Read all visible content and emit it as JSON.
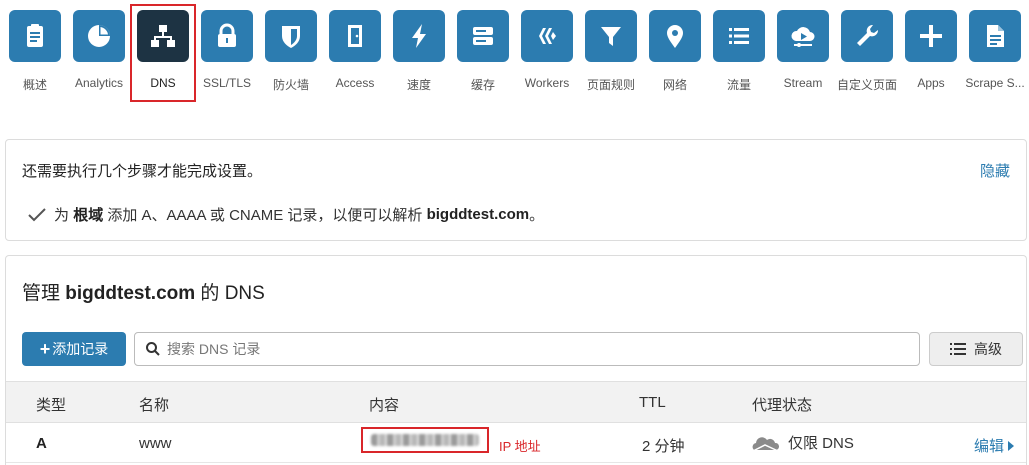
{
  "nav": {
    "items": [
      {
        "label": "概述",
        "icon": "clipboard-icon"
      },
      {
        "label": "Analytics",
        "icon": "pie-chart-icon"
      },
      {
        "label": "DNS",
        "icon": "network-icon"
      },
      {
        "label": "SSL/TLS",
        "icon": "lock-icon"
      },
      {
        "label": "防火墙",
        "icon": "shield-icon"
      },
      {
        "label": "Access",
        "icon": "door-icon"
      },
      {
        "label": "速度",
        "icon": "lightning-icon"
      },
      {
        "label": "缓存",
        "icon": "server-icon"
      },
      {
        "label": "Workers",
        "icon": "workers-icon"
      },
      {
        "label": "页面规则",
        "icon": "filter-icon"
      },
      {
        "label": "网络",
        "icon": "location-pin-icon"
      },
      {
        "label": "流量",
        "icon": "list-icon"
      },
      {
        "label": "Stream",
        "icon": "cloud-play-icon"
      },
      {
        "label": "自定义页面",
        "icon": "wrench-icon"
      },
      {
        "label": "Apps",
        "icon": "plus-icon"
      },
      {
        "label": "Scrape S...",
        "icon": "document-icon"
      }
    ],
    "active": "DNS",
    "accent_color": "#2c7cb0",
    "active_color": "#1d3343"
  },
  "setup": {
    "title": "还需要执行几个步骤才能完成设置。",
    "hide_label": "隐藏",
    "step_prefix": "为",
    "step_bold": "根域",
    "step_mid": "添加 A、AAAA 或 CNAME 记录，以便可以解析",
    "step_domain": "bigddtest.com",
    "step_suffix": "。"
  },
  "dns": {
    "title_prefix": "管理",
    "domain": "bigddtest.com",
    "title_suffix": "的 DNS",
    "add_button": "添加记录",
    "search_placeholder": "搜索 DNS 记录",
    "advanced_button": "高级",
    "columns": {
      "type": "类型",
      "name": "名称",
      "content": "内容",
      "ttl": "TTL",
      "proxy": "代理状态"
    },
    "records": [
      {
        "type": "A",
        "name": "www",
        "content_annotation": "IP 地址",
        "ttl": "2 分钟",
        "proxy_status": "仅限 DNS",
        "edit_label": "编辑"
      }
    ]
  }
}
